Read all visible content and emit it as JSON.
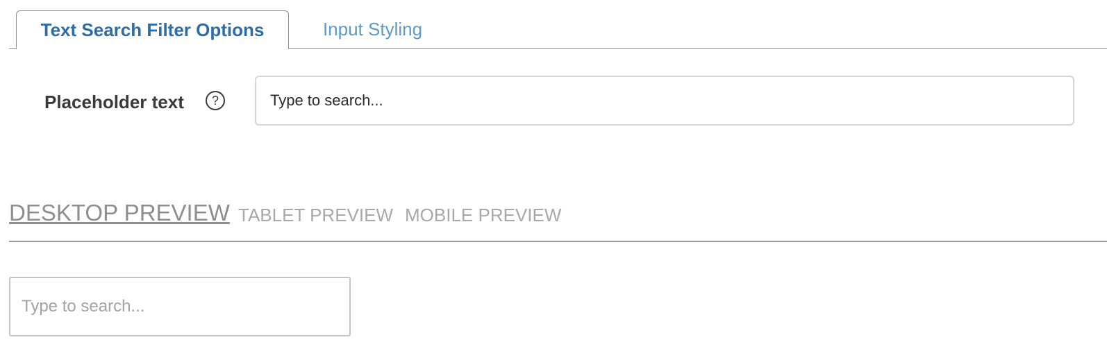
{
  "tabs": [
    {
      "label": "Text Search Filter Options",
      "active": true
    },
    {
      "label": "Input Styling",
      "active": false
    }
  ],
  "settings": {
    "placeholder_label": "Placeholder text",
    "help_icon": "question-circle-icon",
    "help_glyph": "?",
    "placeholder_value": "Type to search..."
  },
  "preview": {
    "tabs": [
      {
        "label": "DESKTOP PREVIEW",
        "active": true
      },
      {
        "label": "TABLET PREVIEW",
        "active": false
      },
      {
        "label": "MOBILE PREVIEW",
        "active": false
      }
    ],
    "search_placeholder": "Type to search..."
  },
  "colors": {
    "active_tab_text": "#2e6da4",
    "inactive_tab_text": "#5b9ac9",
    "border": "#8c8c8c"
  }
}
